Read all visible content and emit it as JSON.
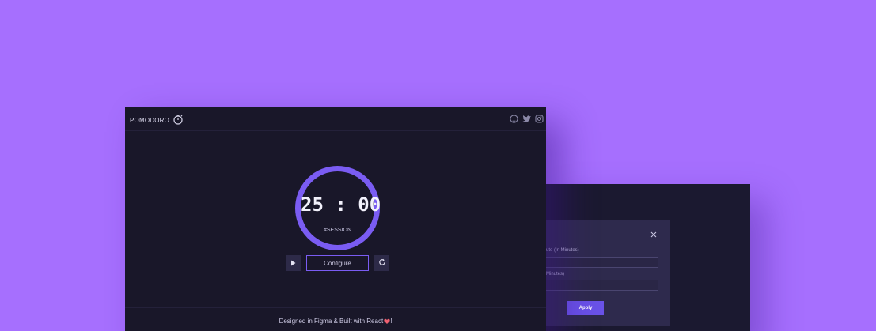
{
  "header": {
    "brand": "POMODORO",
    "social": [
      "github-icon",
      "twitter-icon",
      "instagram-icon"
    ]
  },
  "timer": {
    "time": "25 : 00",
    "label": "#SESSION",
    "configure_label": "Configure"
  },
  "footer": {
    "text": "Designed in Figma & Built with React",
    "suffix": "!"
  },
  "settings": {
    "field1_label": "ute (In Minutes)",
    "field2_label": "Minutes)",
    "apply_label": "Apply"
  },
  "colors": {
    "background": "#a66ffe",
    "window": "#191729",
    "accent": "#7a5cf2",
    "apply": "#6a52e8"
  }
}
